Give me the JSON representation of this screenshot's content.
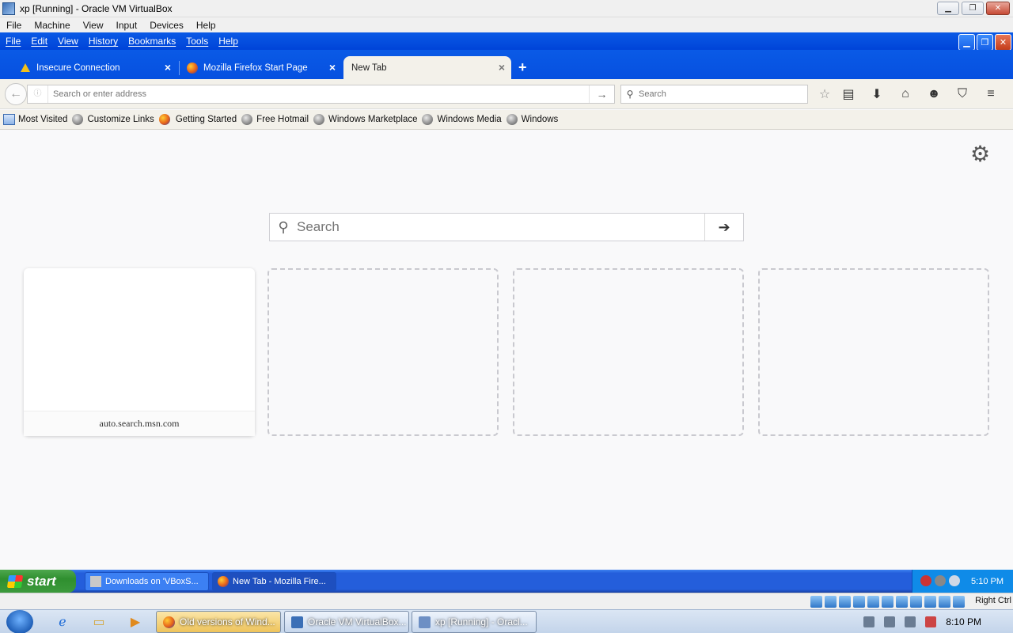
{
  "host": {
    "title": "xp [Running] - Oracle VM VirtualBox",
    "menu": [
      "File",
      "Machine",
      "View",
      "Input",
      "Devices",
      "Help"
    ],
    "controls": {
      "minimize": "▁",
      "restore": "❐",
      "close": "✕"
    }
  },
  "firefox": {
    "menu": [
      "File",
      "Edit",
      "View",
      "History",
      "Bookmarks",
      "Tools",
      "Help"
    ],
    "tabs": [
      {
        "label": "Insecure Connection",
        "icon": "warning-icon",
        "active": false
      },
      {
        "label": "Mozilla Firefox Start Page",
        "icon": "firefox-icon",
        "active": false
      },
      {
        "label": "New Tab",
        "icon": "",
        "active": true
      }
    ],
    "tab_close": "×",
    "new_tab": "+",
    "urlbar": {
      "placeholder": "Search or enter address",
      "value": ""
    },
    "searchbar": {
      "placeholder": "Search",
      "value": ""
    },
    "toolbar_icons": [
      "bookmark-star-icon",
      "reading-list-icon",
      "downloads-icon",
      "home-icon",
      "hello-icon",
      "pocket-icon",
      "menu-icon"
    ],
    "bookmarks": [
      {
        "label": "Most Visited",
        "icon": "most-visited-icon"
      },
      {
        "label": "Customize Links",
        "icon": "globe-icon"
      },
      {
        "label": "Getting Started",
        "icon": "firefox-icon"
      },
      {
        "label": "Free Hotmail",
        "icon": "globe-icon"
      },
      {
        "label": "Windows Marketplace",
        "icon": "globe-icon"
      },
      {
        "label": "Windows Media",
        "icon": "globe-icon"
      },
      {
        "label": "Windows",
        "icon": "globe-icon"
      }
    ]
  },
  "newtab": {
    "search_placeholder": "Search",
    "tiles": [
      {
        "caption": "auto.search.msn.com",
        "filled": true
      },
      {
        "caption": "",
        "filled": false
      },
      {
        "caption": "",
        "filled": false
      },
      {
        "caption": "",
        "filled": false
      }
    ]
  },
  "xp_taskbar": {
    "start": "start",
    "tasks": [
      {
        "label": "Downloads on 'VBoxS...",
        "active": false
      },
      {
        "label": "New Tab - Mozilla Fire...",
        "active": true
      }
    ],
    "clock": "5:10 PM"
  },
  "vbox_status": {
    "host_key": "Right Ctrl"
  },
  "w7_taskbar": {
    "tasks": [
      {
        "label": "Old versions of Wind...",
        "app": "firefox"
      },
      {
        "label": "Oracle VM VirtualBox...",
        "app": "virtualbox"
      },
      {
        "label": "xp [Running] - Oracl...",
        "app": "virtualbox-vm"
      }
    ],
    "clock": "8:10 PM"
  },
  "colors": {
    "xp_blue": "#0a5ae6",
    "start_green": "#3c9a3c",
    "page_bg": "#f9f9fa"
  }
}
